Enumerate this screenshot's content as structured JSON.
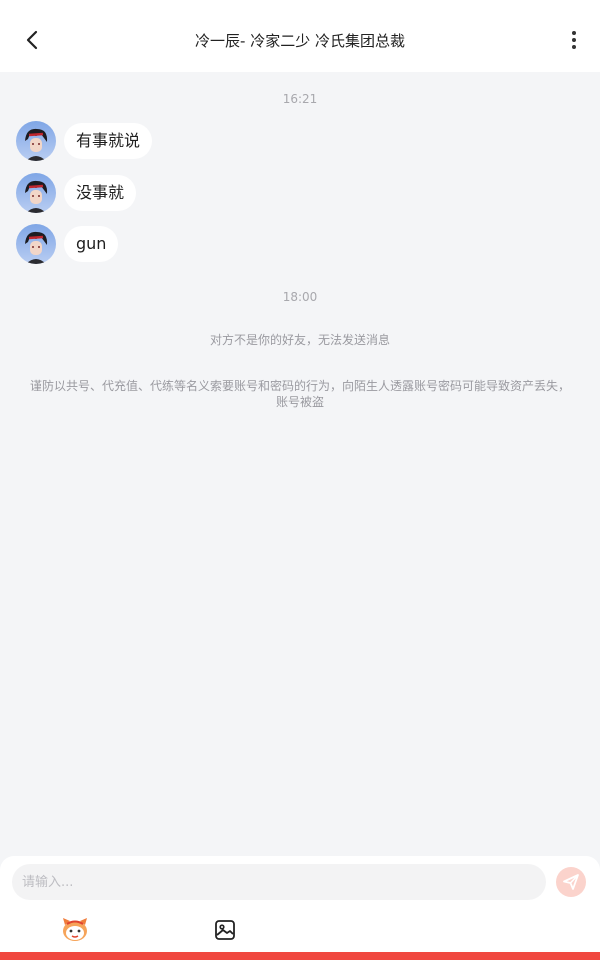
{
  "header": {
    "title": "冷一辰- 冷家二少 冷氏集团总裁",
    "back_icon": "chevron-left-icon",
    "more_icon": "more-vertical-icon"
  },
  "chat": {
    "timestamps": [
      "16:21",
      "18:00"
    ],
    "messages": [
      {
        "text": "有事就说"
      },
      {
        "text": "没事就"
      },
      {
        "text": "gun"
      }
    ],
    "system_notice": "对方不是你的好友，无法发送消息",
    "warning": "谨防以共号、代充值、代练等名义索要账号和密码的行为，向陌生人透露账号密码可能导致资产丢失，账号被盗"
  },
  "composer": {
    "placeholder": "请输入...",
    "send_icon": "paper-plane-icon",
    "emoji_icon": "emoji-mascot-icon",
    "image_icon": "image-icon"
  },
  "colors": {
    "background": "#f4f5f7",
    "bubble": "#ffffff",
    "send_button": "#fbd3cc",
    "accent": "#f0473f"
  }
}
